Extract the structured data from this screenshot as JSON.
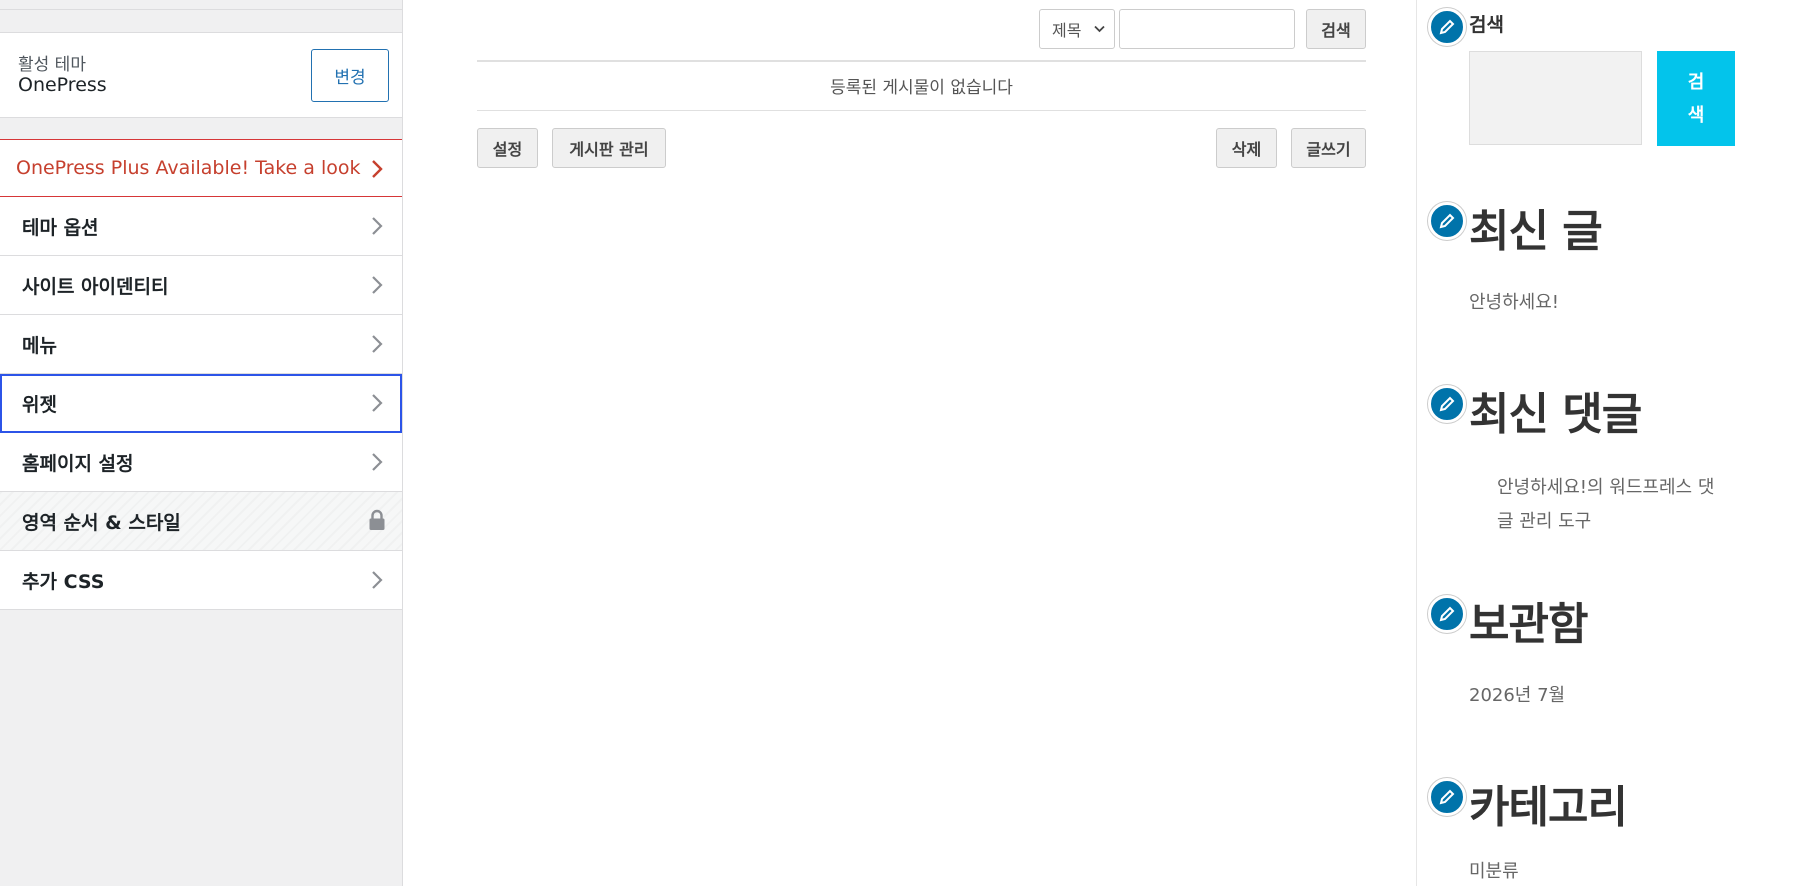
{
  "sidebar": {
    "active_theme_label": "활성 테마",
    "active_theme_name": "OnePress",
    "change_button": "변경",
    "promo_item": "OnePress Plus Available! Take a look",
    "items": [
      {
        "label": "테마 옵션"
      },
      {
        "label": "사이트 아이덴티티"
      },
      {
        "label": "메뉴"
      },
      {
        "label": "위젯"
      },
      {
        "label": "홈페이지 설정"
      },
      {
        "label": "영역 순서 & 스타일"
      },
      {
        "label": "추가 CSS"
      }
    ],
    "active_item": "위젯",
    "locked_item": "영역 순서 & 스타일"
  },
  "board": {
    "search_select_value": "제목",
    "search_input_value": "",
    "search_button": "검색",
    "empty_message": "등록된 게시물이 없습니다",
    "settings_button": "설정",
    "manage_button": "게시판 관리",
    "delete_button": "삭제",
    "write_button": "글쓰기"
  },
  "widgets": {
    "search_title": "검색",
    "search_button_line1": "검",
    "search_button_line2": "색",
    "recent_posts_title": "최신 글",
    "recent_post_1": "안녕하세요!",
    "recent_comments_title": "최신 댓글",
    "recent_comment_line1": "안녕하세요!의 워드프레스 댓",
    "recent_comment_line2": "글 관리 도구",
    "archives_title": "보관함",
    "archive_1": "2026년 7월",
    "categories_title": "카테고리",
    "category_1": "미분류"
  },
  "colors": {
    "accent_blue": "#2271b1",
    "active_outline": "#2c54e8",
    "promo_text": "#c6402e",
    "edit_icon_bg": "#0073aa",
    "search_button_bg": "#03c4eb"
  }
}
